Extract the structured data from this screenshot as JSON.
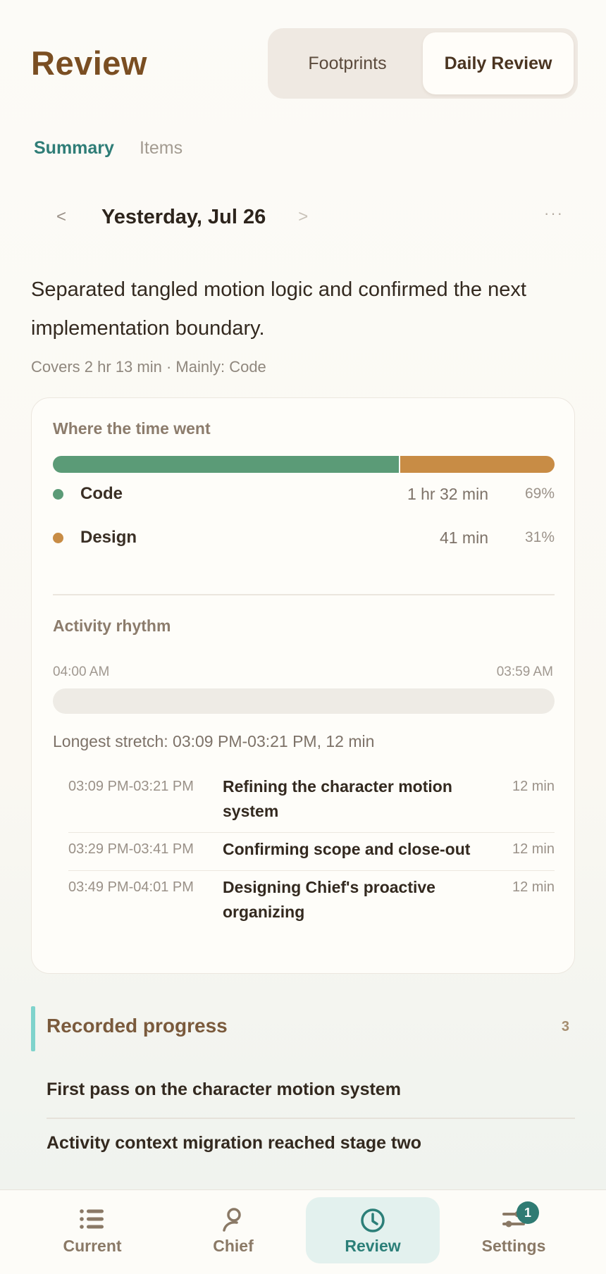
{
  "header": {
    "title": "Review",
    "segments": [
      "Footprints",
      "Daily Review"
    ],
    "active_segment": "Daily Review"
  },
  "subtabs": [
    "Summary",
    "Items"
  ],
  "date_nav": {
    "prev": "<",
    "date": "Yesterday, Jul 26",
    "next": ">",
    "more": "···"
  },
  "summary": {
    "text": "Separated tangled motion logic and confirmed the next implementation boundary.",
    "covers": "Covers 2 hr 13 min · Mainly: Code"
  },
  "time_card": {
    "heading": "Where the time went",
    "categories": [
      {
        "name": "Code",
        "duration": "1 hr 32 min",
        "percent": "69%",
        "share": 0.69,
        "color": "#5b9b77"
      },
      {
        "name": "Design",
        "duration": "41 min",
        "percent": "31%",
        "share": 0.31,
        "color": "#c88c45"
      }
    ],
    "rhythm_heading": "Activity rhythm",
    "rhythm_start": "04:00 AM",
    "rhythm_end": "03:59 AM",
    "longest": "Longest stretch: 03:09 PM-03:21 PM, 12 min",
    "sessions": [
      {
        "time": "03:09 PM-03:21 PM",
        "title": "Refining the character motion system",
        "duration": "12 min"
      },
      {
        "time": "03:29 PM-03:41 PM",
        "title": "Confirming scope and close-out",
        "duration": "12 min"
      },
      {
        "time": "03:49 PM-04:01 PM",
        "title": "Designing Chief's proactive organizing",
        "duration": "12 min"
      }
    ]
  },
  "progress": {
    "title": "Recorded progress",
    "count": "3",
    "items": [
      "First pass on the character motion system",
      "Activity context migration reached stage two"
    ]
  },
  "bottom_nav": {
    "items": [
      {
        "label": "Current",
        "icon": "list-icon"
      },
      {
        "label": "Chief",
        "icon": "person-icon"
      },
      {
        "label": "Review",
        "icon": "clock-icon"
      },
      {
        "label": "Settings",
        "icon": "sliders-icon"
      }
    ],
    "active": "Review",
    "settings_badge": "1"
  }
}
